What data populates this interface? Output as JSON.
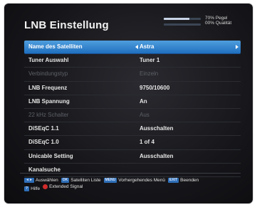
{
  "screen": {
    "title": "LNB Einstellung",
    "meters": {
      "level_text": "70% Pegel",
      "level_fraction": 0.7,
      "quality_text": "00% Qualität",
      "quality_fraction": 0.0
    },
    "rows": [
      {
        "label": "Name des Satelliten",
        "value": "Astra",
        "state": "selected"
      },
      {
        "label": "Tuner Auswahl",
        "value": "Tuner 1",
        "state": "normal"
      },
      {
        "label": "Verbindungstyp",
        "value": "Einzeln",
        "state": "disabled"
      },
      {
        "label": "LNB Frequenz",
        "value": "9750/10600",
        "state": "normal"
      },
      {
        "label": "LNB Spannung",
        "value": "An",
        "state": "normal"
      },
      {
        "label": "22 kHz Schalter",
        "value": "Aus",
        "state": "disabled"
      },
      {
        "label": "DiSEqC 1.1",
        "value": "Ausschalten",
        "state": "normal"
      },
      {
        "label": "DiSEqC 1.0",
        "value": "1 of 4",
        "state": "normal"
      },
      {
        "label": "Unicable Setting",
        "value": "Ausschalten",
        "state": "normal"
      },
      {
        "label": "Kanalsuche",
        "value": "",
        "state": "normal"
      }
    ],
    "help": {
      "line1": [
        {
          "key": "◄►",
          "icon": "left-right-arrows-icon",
          "text": "Auswählen"
        },
        {
          "key": "OK",
          "icon": "ok-key-icon",
          "text": "Satelliten Liste"
        },
        {
          "key": "MENU",
          "icon": "menu-key-icon",
          "text": "Vorhergehendes Menü"
        },
        {
          "key": "EXIT",
          "icon": "exit-key-icon",
          "text": "Beenden"
        }
      ],
      "line2": [
        {
          "key": "?",
          "icon": "help-key-icon",
          "text": "Hilfe"
        },
        {
          "key": "",
          "icon": "red-button-icon",
          "text": "Extended Signal"
        }
      ]
    },
    "colors": {
      "selection": "#3f8fdc",
      "background": "#16161a",
      "text": "#e7e7e7",
      "disabled_text": "#5d6068"
    }
  }
}
